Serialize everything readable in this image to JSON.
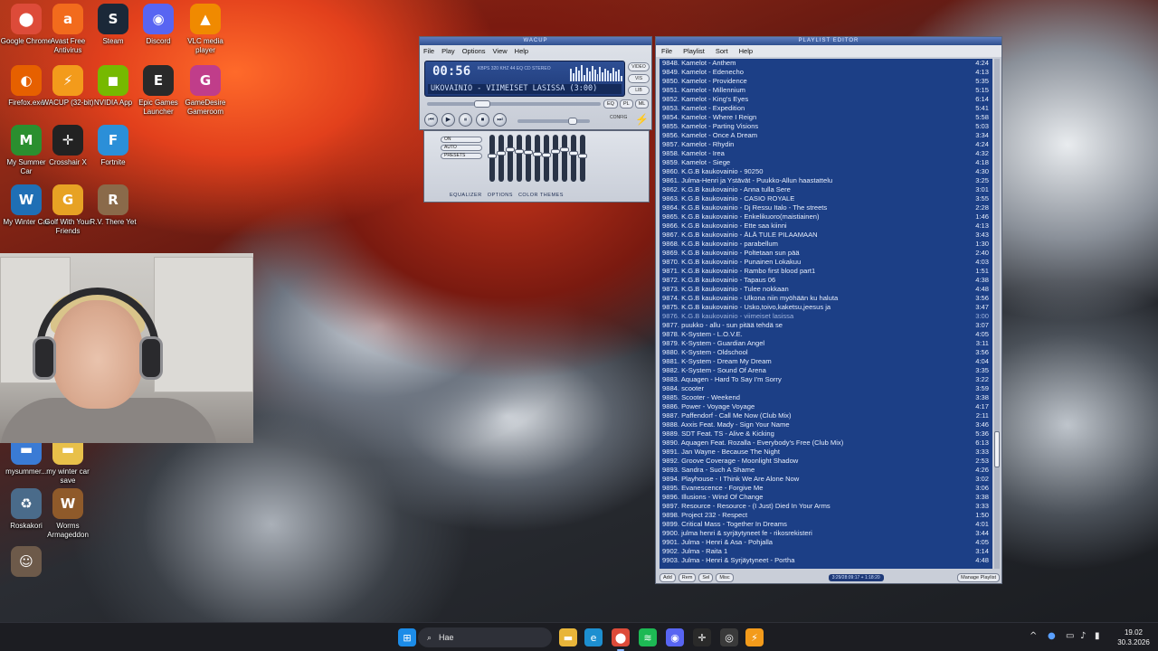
{
  "desktop": {
    "icons": [
      {
        "label": "Google Chrome",
        "glyph": "⬤",
        "color": "#dd4b39"
      },
      {
        "label": "Avast Free Antivirus",
        "glyph": "a",
        "color": "#f26b1d"
      },
      {
        "label": "Steam",
        "glyph": "S",
        "color": "#1b2838"
      },
      {
        "label": "Discord",
        "glyph": "◉",
        "color": "#5865f2"
      },
      {
        "label": "VLC media player",
        "glyph": "▲",
        "color": "#f08a00"
      },
      {
        "label": "Firefox.exe",
        "glyph": "◐",
        "color": "#e66000"
      },
      {
        "label": "WACUP (32-bit)",
        "glyph": "⚡",
        "color": "#f39b1b"
      },
      {
        "label": "NVIDIA App",
        "glyph": "◼",
        "color": "#76b900"
      },
      {
        "label": "Epic Games Launcher",
        "glyph": "E",
        "color": "#2a2a2a"
      },
      {
        "label": "GameDesire Gameroom",
        "glyph": "G",
        "color": "#c03d8a"
      },
      {
        "label": "My Summer Car",
        "glyph": "M",
        "color": "#2b8f2f"
      },
      {
        "label": "Crosshair X",
        "glyph": "✛",
        "color": "#222222"
      },
      {
        "label": "Fortnite",
        "glyph": "F",
        "color": "#2b8fd8"
      },
      {
        "label": "My Winter Car",
        "glyph": "W",
        "color": "#1f6fb5"
      },
      {
        "label": "Golf With Your Friends",
        "glyph": "G",
        "color": "#e7a224"
      },
      {
        "label": "R.V. There Yet",
        "glyph": "R",
        "color": "#8a6a4a"
      },
      {
        "label": "mysummer...",
        "glyph": "▬",
        "color": "#3a7bd5"
      },
      {
        "label": "my winter car save",
        "glyph": "▬",
        "color": "#e8c04a"
      },
      {
        "label": "Roskakori",
        "glyph": "♻",
        "color": "#4a6b8a"
      },
      {
        "label": "Worms Armageddon",
        "glyph": "W",
        "color": "#8f5a2a"
      },
      {
        "label": "",
        "glyph": "☺",
        "color": "#6d5a4a"
      }
    ]
  },
  "winamp": {
    "title": "WACUP",
    "menu": [
      "File",
      "Play",
      "Options",
      "View",
      "Help"
    ],
    "time": "00:56",
    "kbps_text": "KBPS 320 KHZ 44 EQ CD STEREO",
    "song": "UKOVAINIO - VIIMEISET LASISSA (3:00)",
    "side_buttons": [
      "VIDEO",
      "VIS",
      "LIB",
      "PL"
    ],
    "eq_pl": [
      "EQ",
      "PL",
      "ML"
    ],
    "controls": [
      "⏮",
      "▶",
      "⏸",
      "⏹",
      "⏭"
    ],
    "config": "CONFIG",
    "vis_bars": [
      14,
      9,
      16,
      12,
      18,
      7,
      15,
      11,
      17,
      13,
      8,
      16,
      10,
      14,
      12,
      9,
      15,
      11,
      13,
      6
    ]
  },
  "equalizer": {
    "left_pills": [
      "ON",
      "AUTO",
      "PRESETS"
    ],
    "bands": [
      0.45,
      0.38,
      0.3,
      0.33,
      0.36,
      0.4,
      0.42,
      0.35,
      0.3,
      0.38,
      0.45
    ],
    "tabs": [
      "EQUALIZER",
      "OPTIONS",
      "COLOR THEMES"
    ]
  },
  "playlist": {
    "title": "PLAYLIST EDITOR",
    "menu": [
      "File",
      "Playlist",
      "Sort",
      "Help"
    ],
    "current_index": 28,
    "items": [
      {
        "t": "9848. Kamelot - Anthem",
        "d": "4:24"
      },
      {
        "t": "9849. Kamelot - Edenecho",
        "d": "4:13"
      },
      {
        "t": "9850. Kamelot - Providence",
        "d": "5:35"
      },
      {
        "t": "9851. Kamelot - Millennium",
        "d": "5:15"
      },
      {
        "t": "9852. Kamelot - King's Eyes",
        "d": "6:14"
      },
      {
        "t": "9853. Kamelot - Expedition",
        "d": "5:41"
      },
      {
        "t": "9854. Kamelot - Where I Reign",
        "d": "5:58"
      },
      {
        "t": "9855. Kamelot - Parting Visions",
        "d": "5:03"
      },
      {
        "t": "9856. Kamelot - Once A Dream",
        "d": "3:34"
      },
      {
        "t": "9857. Kamelot - Rhydin",
        "d": "4:24"
      },
      {
        "t": "9858. Kamelot - Irea",
        "d": "4:32"
      },
      {
        "t": "9859. Kamelot - Siege",
        "d": "4:18"
      },
      {
        "t": "9860. K.G.B kaukovainio - 90250",
        "d": "4:30"
      },
      {
        "t": "9861. Julma-Henri ja Ystävät - Puukko-Allun haastattelu",
        "d": "3:25"
      },
      {
        "t": "9862. K.G.B kaukovainio - Anna tulla Sere",
        "d": "3:01"
      },
      {
        "t": "9863. K.G.B kaukovainio - CASIO ROYALE",
        "d": "3:55"
      },
      {
        "t": "9864. K.G.B kaukovainio - Dj Ressu Italo - The streets",
        "d": "2:28"
      },
      {
        "t": "9865. K.G.B kaukovainio - Enkelikuoro(maistiainen)",
        "d": "1:46"
      },
      {
        "t": "9866. K.G.B kaukovainio - Ette saa kiinni",
        "d": "4:13"
      },
      {
        "t": "9867. K.G.B kaukovainio - ÄLÄ TULE PILAAMAAN",
        "d": "3:43"
      },
      {
        "t": "9868. K.G.B kaukovainio - parabellum",
        "d": "1:30"
      },
      {
        "t": "9869. K.G.B kaukovainio - Poltetaan sun pää",
        "d": "2:40"
      },
      {
        "t": "9870. K.G.B kaukovainio - Punainen Lokakuu",
        "d": "4:03"
      },
      {
        "t": "9871. K.G.B kaukovainio - Rambo first blood part1",
        "d": "1:51"
      },
      {
        "t": "9872. K.G.B kaukovainio - Tapaus 06",
        "d": "4:38"
      },
      {
        "t": "9873. K.G.B kaukovainio - Tulee nokkaan",
        "d": "4:48"
      },
      {
        "t": "9874. K.G.B kaukovainio - Ulkona niin myöhään ku haluta",
        "d": "3:56"
      },
      {
        "t": "9875. K.G.B kaukovainio - Usko,toivo,kaketsu,jeesus ja",
        "d": "3:47"
      },
      {
        "t": "9876. K.G.B kaukovainio - viimeiset lasissa",
        "d": "3:00"
      },
      {
        "t": "9877. puukko - allu - sun pitää tehdä se",
        "d": "3:07"
      },
      {
        "t": "9878. K-System - L.O.V.E.",
        "d": "4:05"
      },
      {
        "t": "9879. K-System - Guardian Angel",
        "d": "3:11"
      },
      {
        "t": "9880. K-System - Oldschool",
        "d": "3:56"
      },
      {
        "t": "9881. K-System - Dream My Dream",
        "d": "4:04"
      },
      {
        "t": "9882. K-System - Sound Of Arena",
        "d": "3:35"
      },
      {
        "t": "9883. Aquagen - Hard To Say I'm Sorry",
        "d": "3:22"
      },
      {
        "t": "9884. scooter",
        "d": "3:59"
      },
      {
        "t": "9885. Scooter - Weekend",
        "d": "3:38"
      },
      {
        "t": "9886. Power - Voyage Voyage",
        "d": "4:17"
      },
      {
        "t": "9887. Paffendorf - Call Me Now (Club Mix)",
        "d": "2:11"
      },
      {
        "t": "9888. Axxis Feat. Mady - Sign Your Name",
        "d": "3:46"
      },
      {
        "t": "9889. SDT Feat. TS - Alive & Kicking",
        "d": "5:36"
      },
      {
        "t": "9890. Aquagen Feat. Rozalla - Everybody's Free (Club Mix)",
        "d": "6:13"
      },
      {
        "t": "9891. Jan Wayne - Because The Night",
        "d": "3:33"
      },
      {
        "t": "9892. Groove Coverage - Moonlight Shadow",
        "d": "2:53"
      },
      {
        "t": "9893. Sandra - Such A Shame",
        "d": "4:26"
      },
      {
        "t": "9894. Playhouse - I Think We Are Alone Now",
        "d": "3:02"
      },
      {
        "t": "9895. Evanescence - Forgive Me",
        "d": "3:06"
      },
      {
        "t": "9896. Illusions - Wind Of Change",
        "d": "3:38"
      },
      {
        "t": "9897. Resource - Resource - (I Just) Died In Your Arms",
        "d": "3:33"
      },
      {
        "t": "9898. Project 232 - Respect",
        "d": "1:50"
      },
      {
        "t": "9899. Critical Mass - Together In Dreams",
        "d": "4:01"
      },
      {
        "t": "9900. julma henri & syrjäytyneet fe - rikosrekisteri",
        "d": "3:44"
      },
      {
        "t": "9901. Julma - Henri & Asa - Pohjalla",
        "d": "4:05"
      },
      {
        "t": "9902. Julma - Raita 1",
        "d": "3:14"
      },
      {
        "t": "9903. Julma - Henri & Syrjäytyneet - Portha",
        "d": "4:48"
      }
    ],
    "bottom_buttons": [
      "Add",
      "Rem",
      "Sel",
      "Misc"
    ],
    "info": "3:29/28:09:17 + 1:18:20",
    "manage": "Manage Playlist"
  },
  "taskbar": {
    "search_placeholder": "Hae",
    "time": "19.02",
    "date": "30.3.2026",
    "apps": [
      {
        "name": "start",
        "glyph": "⊞",
        "color": "#1c8ce8"
      },
      {
        "name": "file-explorer",
        "glyph": "▬",
        "color": "#e8b53a"
      },
      {
        "name": "edge",
        "glyph": "e",
        "color": "#1d8fd0"
      },
      {
        "name": "chrome",
        "glyph": "⬤",
        "color": "#dd4b39"
      },
      {
        "name": "spotify",
        "glyph": "≋",
        "color": "#1db954"
      },
      {
        "name": "discord",
        "glyph": "◉",
        "color": "#5865f2"
      },
      {
        "name": "crosshair",
        "glyph": "✛",
        "color": "#2a2a2a"
      },
      {
        "name": "obs",
        "glyph": "◎",
        "color": "#3a3a3a"
      },
      {
        "name": "wacup",
        "glyph": "⚡",
        "color": "#f39b1b"
      }
    ]
  }
}
